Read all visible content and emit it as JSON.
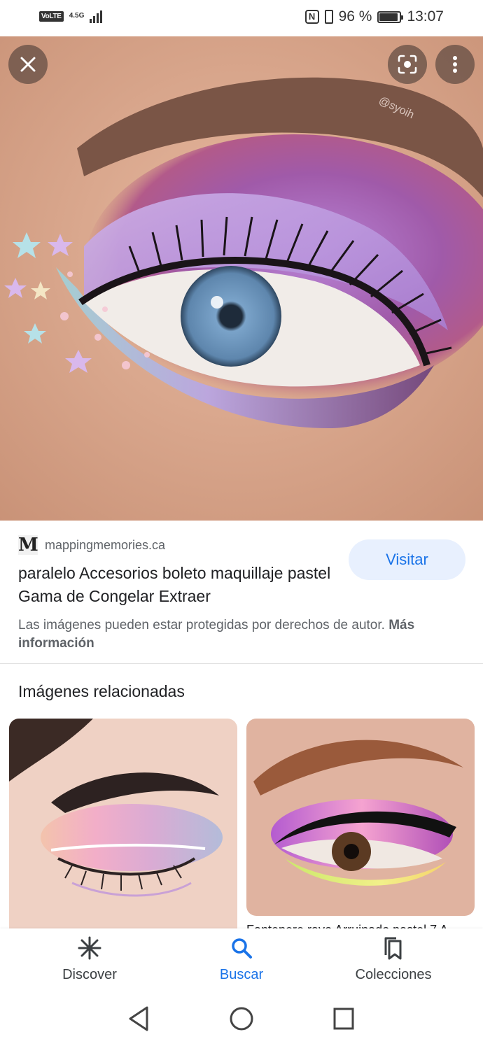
{
  "status_bar": {
    "volte": "VoLTE",
    "network": "4.5G",
    "battery_percent": "96 %",
    "time": "13:07"
  },
  "hero": {
    "watermark": "@syoih"
  },
  "result": {
    "favicon_letter": "M",
    "domain": "mappingmemories.ca",
    "title": "paralelo Accesorios boleto maquillaje pastel Gama de Congelar Extraer",
    "visit_label": "Visitar",
    "copyright_notice": "Las imágenes pueden estar protegidas por derechos de autor.",
    "more_info": "Más información"
  },
  "related": {
    "heading": "Imágenes relacionadas",
    "card2_caption": "Fantenere rayo Arruinado pastel 7 A"
  },
  "bottom_nav": {
    "items": [
      {
        "label": "Discover",
        "icon": "asterisk-icon",
        "active": false
      },
      {
        "label": "Buscar",
        "icon": "search-icon",
        "active": true
      },
      {
        "label": "Colecciones",
        "icon": "bookmarks-icon",
        "active": false
      }
    ]
  },
  "colors": {
    "accent": "#1a73e8",
    "visit_bg": "#e8f0fe"
  }
}
